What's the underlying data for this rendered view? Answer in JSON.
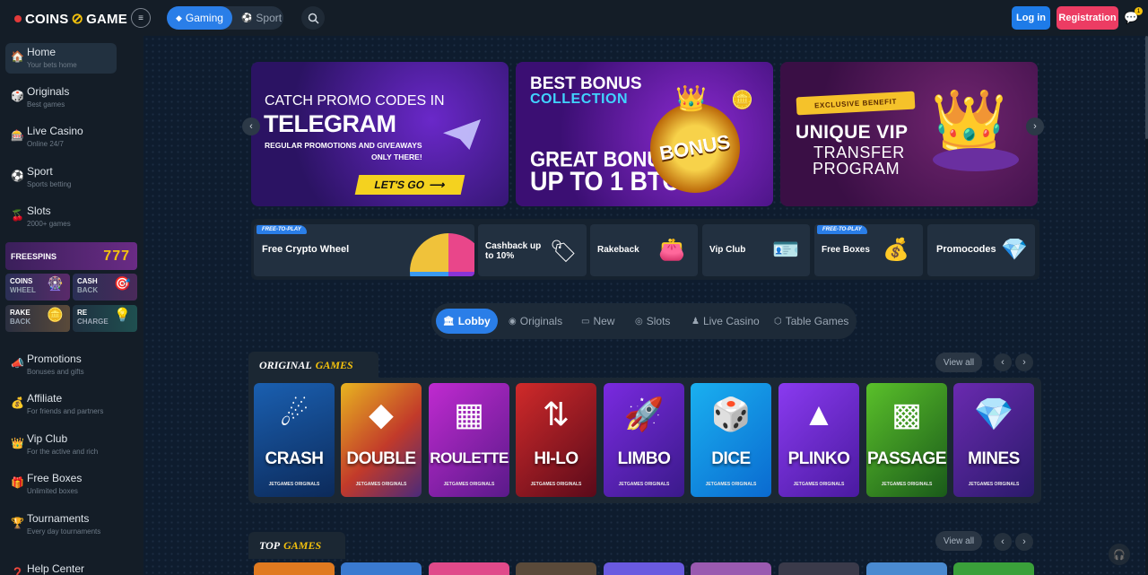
{
  "header": {
    "logo_left": "COINS",
    "logo_right": "GAME",
    "menu_icon": "≡",
    "toggle": [
      {
        "label": "Gaming",
        "icon": "◆",
        "active": true
      },
      {
        "label": "Sport",
        "icon": "⚽",
        "active": false
      }
    ],
    "login": "Log in",
    "register": "Registration",
    "chat_badge": "1"
  },
  "sidebar": {
    "items": [
      {
        "label": "Home",
        "sub": "Your bets home",
        "icon": "🏠"
      },
      {
        "label": "Originals",
        "sub": "Best games",
        "icon": "🎲"
      },
      {
        "label": "Live Casino",
        "sub": "Online 24/7",
        "icon": "🎰"
      },
      {
        "label": "Sport",
        "sub": "Sports betting",
        "icon": "⚽"
      },
      {
        "label": "Slots",
        "sub": "2000+ games",
        "icon": "🍒"
      },
      {
        "label": "Promotions",
        "sub": "Bonuses and gifts",
        "icon": "📣"
      },
      {
        "label": "Affiliate",
        "sub": "For friends and partners",
        "icon": "💰"
      },
      {
        "label": "Vip Club",
        "sub": "For the active and rich",
        "icon": "👑"
      },
      {
        "label": "Free Boxes",
        "sub": "Unlimited boxes",
        "icon": "🎁"
      },
      {
        "label": "Tournaments",
        "sub": "Every day tournaments",
        "icon": "🏆"
      },
      {
        "label": "Help Center",
        "sub": "",
        "icon": "❓"
      }
    ],
    "freespins": {
      "label": "FREESPINS",
      "value": "777"
    },
    "minis": [
      {
        "l1": "COINS",
        "l2": "WHEEL",
        "icon": "🎡"
      },
      {
        "l1": "CASH",
        "l2": "BACK",
        "icon": "🎯"
      },
      {
        "l1": "RAKE",
        "l2": "BACK",
        "icon": "🪙"
      },
      {
        "l1": "RE",
        "l2": "CHARGE",
        "icon": "💡"
      }
    ]
  },
  "banners": [
    {
      "l1": "CATCH PROMO CODES IN",
      "l2": "TELEGRAM",
      "l3": "REGULAR PROMOTIONS AND GIVEAWAYS",
      "l4": "ONLY THERE!",
      "cta": "LET'S GO"
    },
    {
      "l1": "BEST BONUS",
      "l2": "COLLECTION",
      "l3": "GREAT BONUS",
      "l4": "UP TO 1 BTC",
      "badge": "BONUS"
    },
    {
      "l1": "EXCLUSIVE BENEFIT",
      "l2": "UNIQUE VIP",
      "l3": "TRANSFER",
      "l4": "PROGRAM"
    }
  ],
  "quick": [
    {
      "label": "Free Crypto Wheel",
      "tag": "FREE-TO-PLAY"
    },
    {
      "label": "Cashback up to 10%",
      "tag": ""
    },
    {
      "label": "Rakeback",
      "tag": ""
    },
    {
      "label": "Vip Club",
      "tag": ""
    },
    {
      "label": "Free Boxes",
      "tag": "FREE-TO-PLAY"
    },
    {
      "label": "Promocodes",
      "tag": ""
    }
  ],
  "categories": [
    {
      "label": "Lobby",
      "icon": "🏛",
      "active": true
    },
    {
      "label": "Originals",
      "icon": "◉",
      "active": false
    },
    {
      "label": "New",
      "icon": "▭",
      "active": false
    },
    {
      "label": "Slots",
      "icon": "◎",
      "active": false
    },
    {
      "label": "Live Casino",
      "icon": "♟",
      "active": false
    },
    {
      "label": "Table Games",
      "icon": "⬡",
      "active": false
    }
  ],
  "originals": {
    "title_a": "ORIGINAL",
    "title_b": "GAMES",
    "view_all": "View all",
    "games": [
      {
        "name": "CRASH",
        "sub": "JETGAMES ORIGINALS"
      },
      {
        "name": "DOUBLE",
        "sub": "JETGAMES ORIGINALS"
      },
      {
        "name": "ROULETTE",
        "sub": "JETGAMES ORIGINALS"
      },
      {
        "name": "HI-LO",
        "sub": "JETGAMES ORIGINALS"
      },
      {
        "name": "LIMBO",
        "sub": "JETGAMES ORIGINALS"
      },
      {
        "name": "DICE",
        "sub": "JETGAMES ORIGINALS"
      },
      {
        "name": "PLINKO",
        "sub": "JETGAMES ORIGINALS"
      },
      {
        "name": "PASSAGE",
        "sub": "JETGAMES ORIGINALS"
      },
      {
        "name": "MINES",
        "sub": "JETGAMES ORIGINALS"
      }
    ]
  },
  "top": {
    "title_a": "TOP",
    "title_b": "GAMES",
    "view_all": "View all"
  }
}
